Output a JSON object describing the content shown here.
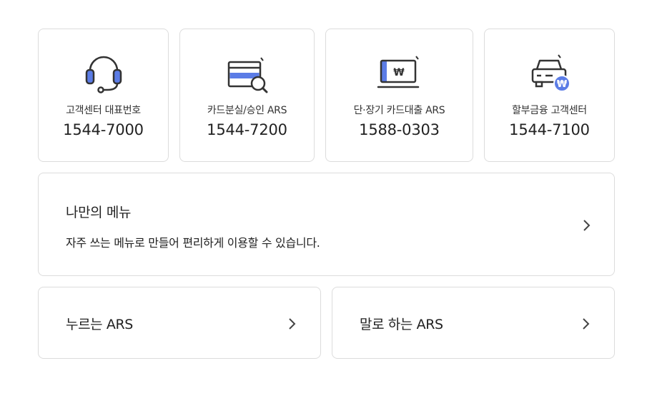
{
  "contacts": [
    {
      "label": "고객센터 대표번호",
      "number": "1544-7000",
      "icon": "headset-icon"
    },
    {
      "label": "카드분실/승인 ARS",
      "number": "1544-7200",
      "icon": "card-search-icon"
    },
    {
      "label": "단·장기 카드대출 ARS",
      "number": "1588-0303",
      "icon": "won-screen-icon"
    },
    {
      "label": "할부금융 고객센터",
      "number": "1544-7100",
      "icon": "car-won-icon"
    }
  ],
  "my_menu": {
    "title": "나만의 메뉴",
    "description": "자주 쓰는 메뉴로 만들어 편리하게 이용할 수 있습니다."
  },
  "ars": {
    "press": "누르는 ARS",
    "voice": "말로 하는 ARS"
  },
  "colors": {
    "accent": "#5b7ce6",
    "icon_stroke": "#333333",
    "border": "#dcdcdc",
    "text": "#222222"
  }
}
